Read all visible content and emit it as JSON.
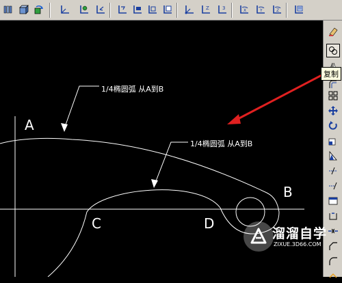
{
  "toolbar": {
    "icons": [
      "view-3d-icon",
      "box-3d-icon",
      "rotate-3d-icon",
      "ucs-icon",
      "ucs-named-icon",
      "ucs-previous-icon",
      "ucs-world-icon",
      "ucs-object-icon",
      "ucs-face-icon",
      "ucs-view-icon",
      "ucs-origin-icon",
      "ucs-z-axis-icon",
      "ucs-3point-icon",
      "ucs-x-icon",
      "ucs-y-icon",
      "ucs-z-icon",
      "ucs-apply-icon"
    ]
  },
  "modify_toolbar": {
    "icons": [
      "erase-icon",
      "copy-icon",
      "mirror-icon",
      "offset-icon",
      "array-icon",
      "move-icon",
      "rotate-icon",
      "scale-icon",
      "stretch-icon",
      "trim-icon",
      "extend-icon",
      "break-icon",
      "break-point-icon",
      "join-icon",
      "chamfer-icon",
      "fillet-icon",
      "explode-icon"
    ]
  },
  "tooltip": {
    "text": "复制"
  },
  "drawing": {
    "annotation_1": "1/4椭圆弧  从A到B",
    "annotation_2": "1/4椭圆弧  从A到B",
    "label_a": "A",
    "label_b": "B",
    "label_c": "C",
    "label_d": "D",
    "line_color": "#ffffff",
    "arrow_color": "#e02020"
  },
  "watermark": {
    "title": "溜溜自学",
    "url": "ZIXUE.3D66.COM"
  }
}
